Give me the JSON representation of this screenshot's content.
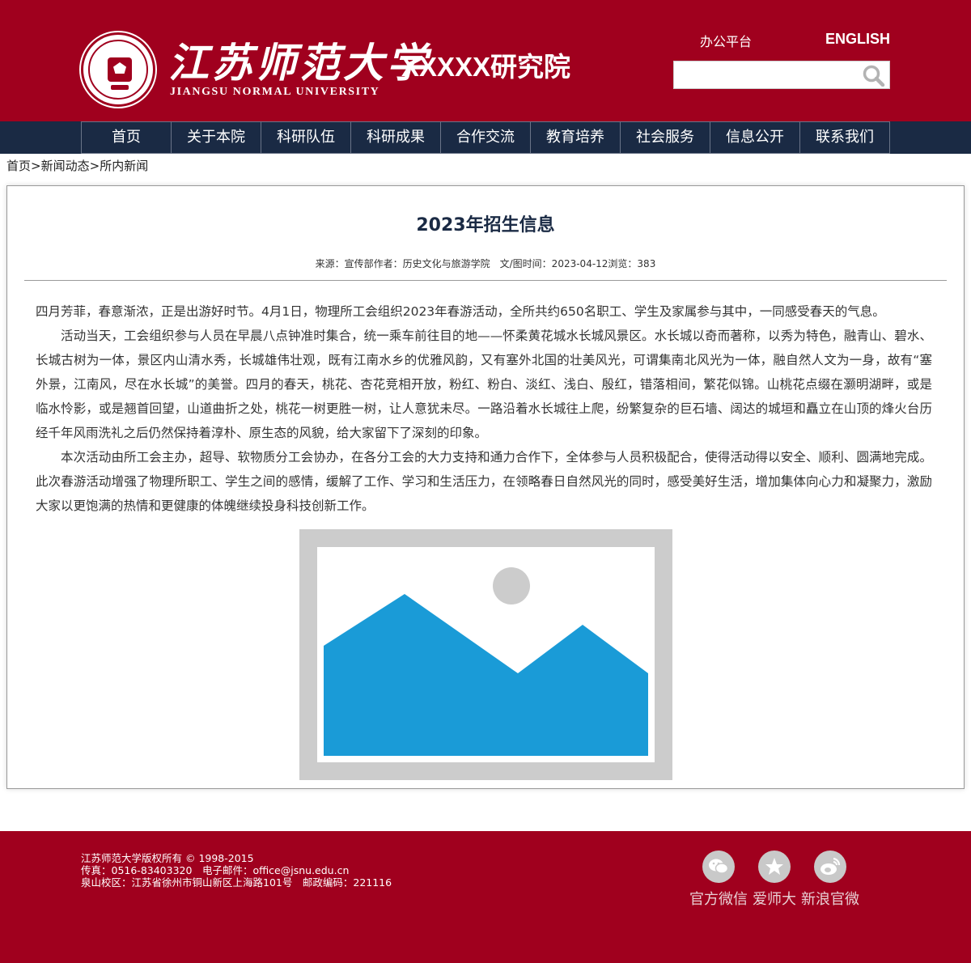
{
  "header": {
    "university_cn": "江苏师范大学",
    "university_en": "JIANGSU NORMAL UNIVERSITY",
    "institute": "XXXXX研究院",
    "office_platform": "办公平台",
    "english": "ENGLISH",
    "search": {
      "value": "",
      "placeholder": ""
    }
  },
  "nav": {
    "items": [
      "首页",
      "关于本院",
      "科研队伍",
      "科研成果",
      "合作交流",
      "教育培养",
      "社会服务",
      "信息公开",
      "联系我们"
    ]
  },
  "breadcrumb": {
    "home": "首页",
    "sep1": ">",
    "section": "新闻动态",
    "sep2": ">",
    "current": "所内新闻"
  },
  "article": {
    "title": "2023年招生信息",
    "meta": "来源：宣传部作者：历史文化与旅游学院　文/图时间：2023-04-12浏览：383",
    "paragraphs": [
      "四月芳菲，春意渐浓，正是出游好时节。4月1日，物理所工会组织2023年春游活动，全所共约650名职工、学生及家属参与其中，一同感受春天的气息。",
      "活动当天，工会组织参与人员在早晨八点钟准时集合，统一乘车前往目的地——怀柔黄花城水长城风景区。水长城以奇而著称，以秀为特色，融青山、碧水、长城古树为一体，景区内山清水秀，长城雄伟壮观，既有江南水乡的优雅风韵，又有塞外北国的壮美风光，可谓集南北风光为一体，融自然人文为一身，故有“塞外景，江南风，尽在水长城”的美誉。四月的春天，桃花、杏花竞相开放，粉红、粉白、淡红、浅白、殷红，错落相间，繁花似锦。山桃花点缀在灏明湖畔，或是临水怜影，或是翘首回望，山道曲折之处，桃花一树更胜一树，让人意犹未尽。一路沿着水长城往上爬，纷繁复杂的巨石墙、阔达的城垣和矗立在山顶的烽火台历经千年风雨洗礼之后仍然保持着淳朴、原生态的风貌，给大家留下了深刻的印象。",
      "本次活动由所工会主办，超导、软物质分工会协办，在各分工会的大力支持和通力合作下，全体参与人员积极配合，使得活动得以安全、顺利、圆满地完成。此次春游活动增强了物理所职工、学生之间的感情，缓解了工作、学习和生活压力，在领略春日自然风光的同时，感受美好生活，增加集体向心力和凝聚力，激励大家以更饱满的热情和更健康的体魄继续投身科技创新工作。"
    ],
    "image_icon": "image-placeholder-icon"
  },
  "footer": {
    "copyright": "江苏师范大学版权所有 © 1998-2015",
    "contact": "传真：0516-83403320　电子邮件：office@jsnu.edu.cn",
    "address": "泉山校区：江苏省徐州市铜山新区上海路101号　邮政编码：221116",
    "social": [
      {
        "label": "官方微信",
        "icon": "wechat-icon"
      },
      {
        "label": "爱师大",
        "icon": "app-icon"
      },
      {
        "label": "新浪官微",
        "icon": "weibo-icon"
      }
    ]
  },
  "colors": {
    "brand_red": "#a0001e",
    "nav_navy": "#1a2a44",
    "placeholder_blue": "#1a9bd7",
    "placeholder_gray": "#cccccc"
  }
}
